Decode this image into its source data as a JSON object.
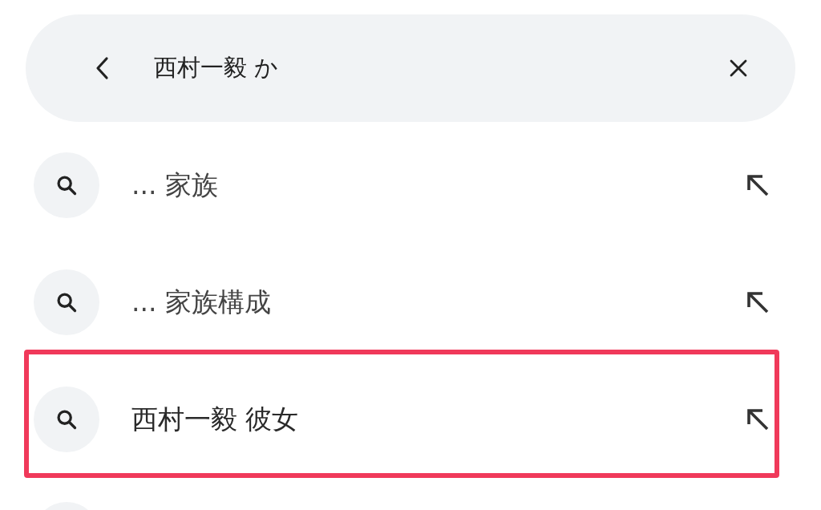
{
  "search": {
    "value": "西村一毅 か"
  },
  "suggestions": [
    {
      "kind": "suggestion",
      "text": "... 家族",
      "highlighted": false
    },
    {
      "kind": "suggestion",
      "text": "... 家族構成",
      "highlighted": false
    },
    {
      "kind": "suggestion",
      "text": "西村一毅 彼女",
      "highlighted": true
    },
    {
      "kind": "cut-off"
    }
  ]
}
